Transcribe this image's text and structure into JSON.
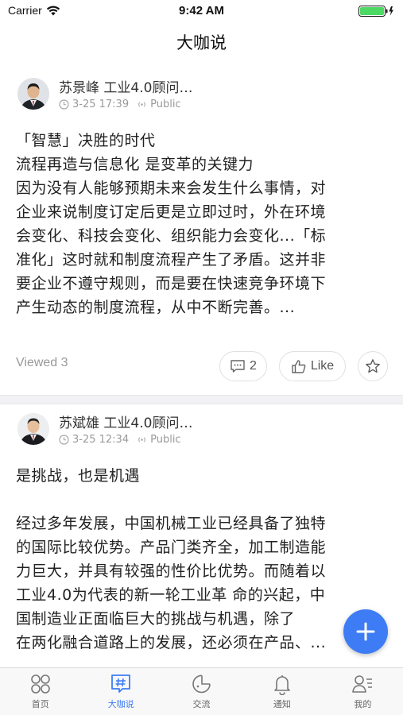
{
  "status_bar": {
    "carrier": "Carrier",
    "time": "9:42 AM"
  },
  "nav": {
    "title": "大咖说"
  },
  "posts": [
    {
      "author": "苏景峰 工业4.0顾问…",
      "time": "3-25 17:39",
      "visibility": "Public",
      "lines": [
        "「智慧」决胜的时代",
        "流程再造与信息化 是变革的关键力",
        "因为没有人能够预期未来会发生什么事情，对",
        "企业来说制度订定后更是立即过时，外在环境",
        "会变化、科技会变化、组织能力会变化...「标",
        "准化」这时就和制度流程产生了矛盾。这并非",
        "要企业不遵守规则，而是要在快速竞争环境下",
        "产生动态的制度流程，从中不断完善。..."
      ],
      "viewed": "Viewed 3",
      "comments": "2",
      "like_label": "Like"
    },
    {
      "author": "苏斌雄 工业4.0顾问…",
      "time": "3-25 12:34",
      "visibility": "Public",
      "lines": [
        "是挑战，也是机遇",
        "",
        "经过多年发展，中国机械工业已经具备了独特",
        "的国际比较优势。产品门类齐全，加工制造能",
        "力巨大，并具有较强的性价比优势。而随着以",
        "工业4.0为代表的新一轮工业革  命的兴起，中",
        "国制造业正面临巨大的挑战与机遇，除了",
        "在两化融合道路上的发展，还必须在产品、..."
      ]
    }
  ],
  "tabs": [
    {
      "label": "首页",
      "icon": "grid-icon"
    },
    {
      "label": "大咖说",
      "icon": "hashtag-chat-icon"
    },
    {
      "label": "交流",
      "icon": "chat-bubble-icon"
    },
    {
      "label": "通知",
      "icon": "bell-icon"
    },
    {
      "label": "我的",
      "icon": "profile-icon"
    }
  ],
  "colors": {
    "accent": "#3d7cf5",
    "muted": "#999999",
    "battery": "#4cd964"
  }
}
